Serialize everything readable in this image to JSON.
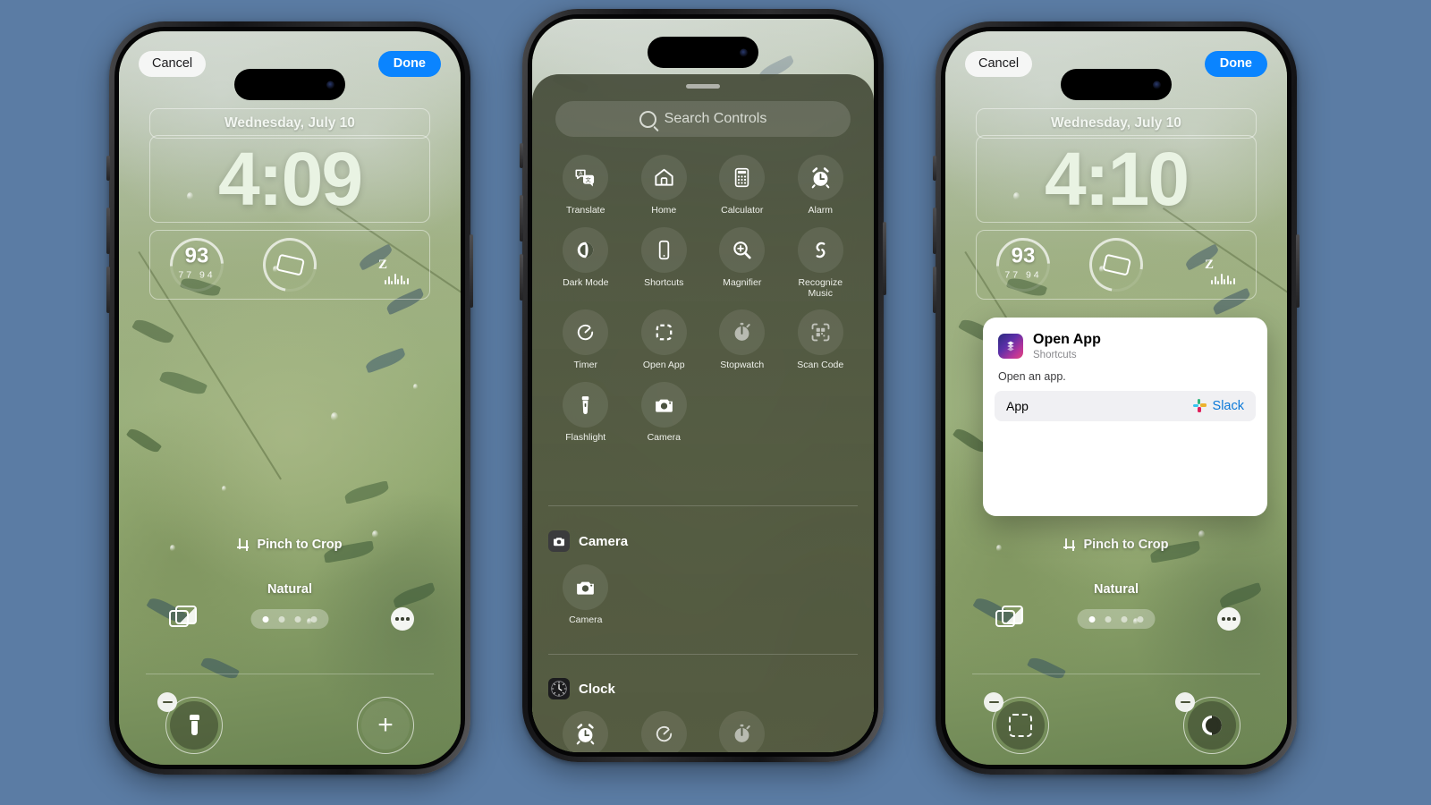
{
  "background_color": "#5b7ca4",
  "phones": {
    "left": {
      "name": "lock-screen-editor",
      "cancel_label": "Cancel",
      "done_label": "Done",
      "date": "Wednesday, July 10",
      "time": "4:09",
      "widgets": {
        "air_quality": {
          "value": "93",
          "low": "77",
          "high": "94"
        },
        "middle": "phone-battery-ring",
        "sleep": "Z"
      },
      "pinch_label": "Pinch to Crop",
      "style_name": "Natural",
      "page_dots": {
        "count": 4,
        "active_index": 0
      },
      "photo_icon": "photo-library-icon",
      "more_icon": "more-options-icon",
      "bottom_left_control": {
        "icon": "flashlight-icon",
        "filled": true
      },
      "bottom_right_control": {
        "icon": "plus-icon",
        "filled": false
      }
    },
    "middle": {
      "name": "controls-gallery",
      "search_placeholder": "Search Controls",
      "search_icon": "search-icon",
      "controls": [
        {
          "label": "Translate",
          "icon": "translate-icon"
        },
        {
          "label": "Home",
          "icon": "home-icon"
        },
        {
          "label": "Calculator",
          "icon": "calculator-icon"
        },
        {
          "label": "Alarm",
          "icon": "alarm-clock-icon"
        },
        {
          "label": "Dark Mode",
          "icon": "dark-mode-icon"
        },
        {
          "label": "Shortcuts",
          "icon": "shortcuts-phone-icon"
        },
        {
          "label": "Magnifier",
          "icon": "magnifier-icon"
        },
        {
          "label": "Recognize Music",
          "icon": "shazam-icon"
        },
        {
          "label": "Timer",
          "icon": "timer-icon"
        },
        {
          "label": "Open App",
          "icon": "open-app-icon"
        },
        {
          "label": "Stopwatch",
          "icon": "stopwatch-icon"
        },
        {
          "label": "Scan Code",
          "icon": "scan-code-icon"
        },
        {
          "label": "Flashlight",
          "icon": "flashlight-icon"
        },
        {
          "label": "Camera",
          "icon": "camera-icon"
        }
      ],
      "sections": [
        {
          "title": "Camera",
          "app_icon": "camera-app-icon",
          "items": [
            {
              "label": "Camera",
              "icon": "camera-icon"
            }
          ]
        },
        {
          "title": "Clock",
          "app_icon": "clock-app-icon",
          "items": [
            {
              "label": "",
              "icon": "alarm-clock-icon"
            },
            {
              "label": "",
              "icon": "timer-icon"
            },
            {
              "label": "",
              "icon": "stopwatch-icon"
            }
          ]
        }
      ]
    },
    "right": {
      "name": "lock-screen-editor-with-dialog",
      "cancel_label": "Cancel",
      "done_label": "Done",
      "date": "Wednesday, July 10",
      "time": "4:10",
      "widgets": {
        "air_quality": {
          "value": "93",
          "low": "77",
          "high": "94"
        },
        "middle": "phone-battery-ring",
        "sleep": "Z"
      },
      "pinch_label": "Pinch to Crop",
      "style_name": "Natural",
      "page_dots": {
        "count": 4,
        "active_index": 0
      },
      "photo_icon": "photo-library-icon",
      "more_icon": "more-options-icon",
      "bottom_left_control": {
        "icon": "open-app-icon",
        "filled": true
      },
      "bottom_right_control": {
        "icon": "dark-mode-icon",
        "filled": true
      },
      "dialog": {
        "title": "Open App",
        "subtitle": "Shortcuts",
        "app_icon": "shortcuts-app-icon",
        "description": "Open an app.",
        "parameter_label": "App",
        "parameter_value": "Slack",
        "parameter_value_icon": "slack-icon",
        "parameter_value_color": "#0a78d8"
      }
    }
  }
}
